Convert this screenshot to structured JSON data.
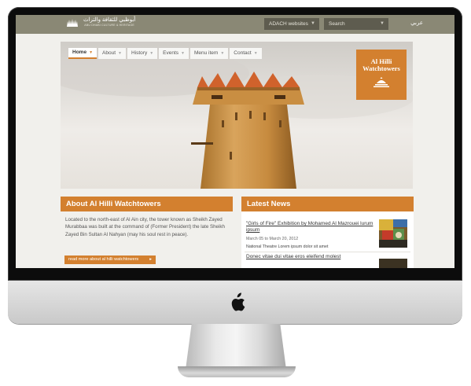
{
  "site": {
    "logo_arabic": "أبوظبي للثقافة والتراث",
    "logo_english": "ABU DHABI CULTURE & HERITAGE"
  },
  "topbar": {
    "websites_label": "ADACH websites",
    "search_placeholder": "Search",
    "arabic_link": "عربي"
  },
  "nav": {
    "items": [
      {
        "label": "Home"
      },
      {
        "label": "About"
      },
      {
        "label": "History"
      },
      {
        "label": "Events"
      },
      {
        "label": "Menu item"
      },
      {
        "label": "Contact"
      }
    ]
  },
  "badge": {
    "title_line1": "Al Hilli",
    "title_line2": "Watchtowers"
  },
  "about": {
    "heading": "About Al Hilli Watchtowers",
    "text": "Located to the north-east of Al Ain city, the tower known as Sheikh Zayed Murabbaa was built at the command of (Former President) the late Sheikh Zayed Bin Sultan Al Nahyan (may his soul rest in peace).",
    "read_more": "read more about al hilli watchtowers"
  },
  "news": {
    "heading": "Latest News",
    "items": [
      {
        "title": "\"Girls of Fire\" Exhibition by Mohamed Al Mazrouei lurum ipsum",
        "date": "March 05 to March 20, 2012",
        "description": "National Theatre Lorem ipsum dolor sit amet"
      },
      {
        "title": "Donec vitae dui vitae eros eleifend molest"
      }
    ]
  },
  "colors": {
    "accent": "#d3802f",
    "topbar": "#8a8875",
    "background": "#f1f0ec"
  }
}
